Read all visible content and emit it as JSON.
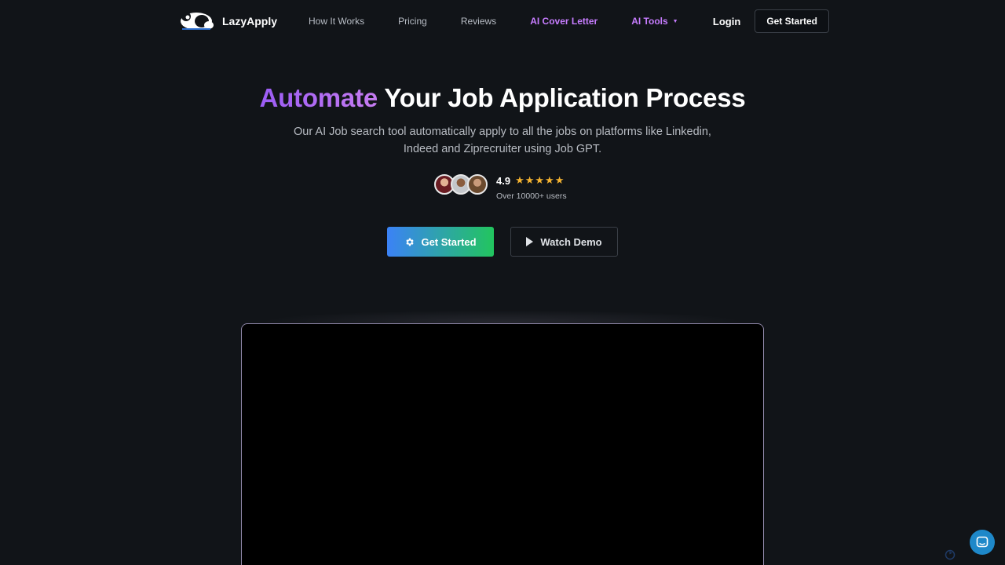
{
  "brand": {
    "name": "LazyApply",
    "logo_icon": "panda-logo-icon"
  },
  "nav": {
    "links": [
      {
        "label": "How It Works"
      },
      {
        "label": "Pricing"
      },
      {
        "label": "Reviews"
      },
      {
        "label": "AI Cover Letter"
      }
    ],
    "dropdown_label": "AI Tools",
    "login_label": "Login",
    "cta_label": "Get Started"
  },
  "hero": {
    "title_highlight": "Automate",
    "title_rest": " Your Job Application Process",
    "subtitle_line1": "Our AI Job search tool automatically apply to all the jobs on platforms like Linkedin,",
    "subtitle_line2": "Indeed and Ziprecruiter using Job GPT.",
    "rating_score": "4.9",
    "rating_stars": "★★★★★",
    "rating_value": 5,
    "users_text": "Over 10000+ users",
    "primary_cta": "Get Started",
    "secondary_cta": "Watch Demo"
  },
  "colors": {
    "background": "#111418",
    "accent_purple": "#c77dff",
    "star": "#f6b431",
    "cta_gradient_start": "#3b82f6",
    "cta_gradient_end": "#22c55e",
    "chat": "#1e88c9"
  }
}
